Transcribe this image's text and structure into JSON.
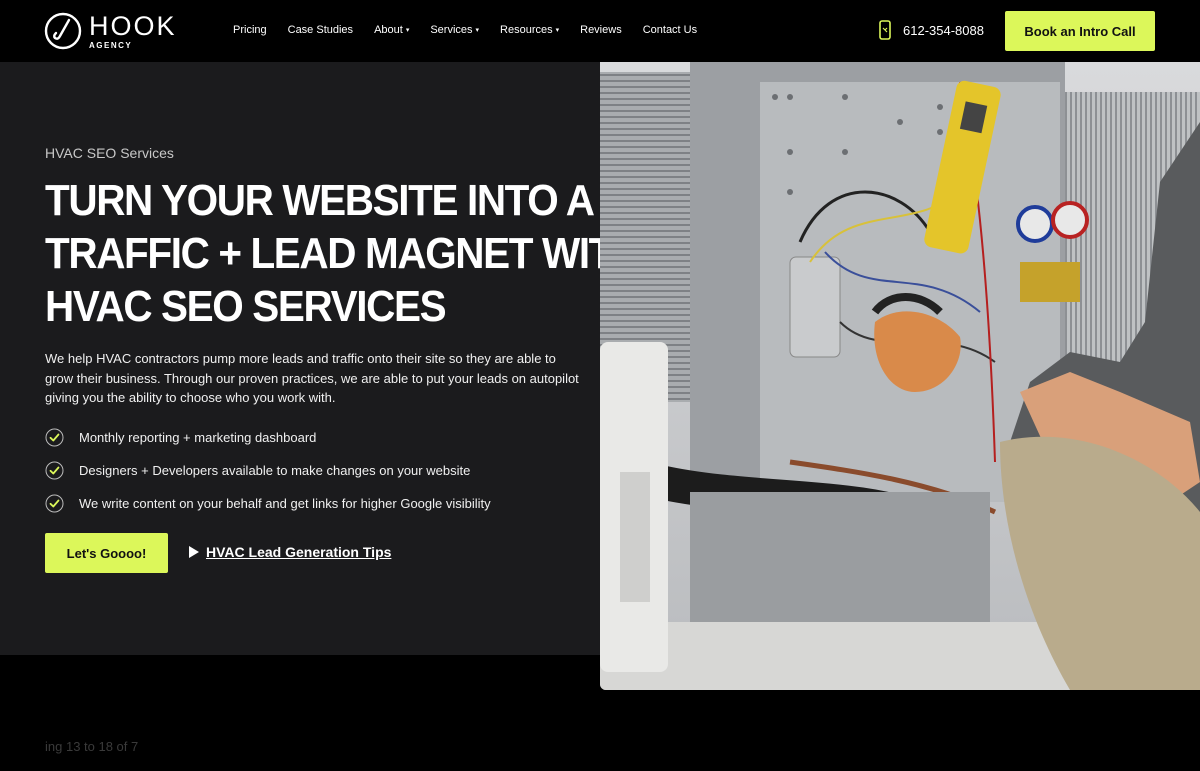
{
  "brand": {
    "name": "HOOK",
    "sub": "AGENCY",
    "logo_icon": "hook-logo-icon"
  },
  "nav": {
    "items": [
      {
        "label": "Pricing",
        "dropdown": false
      },
      {
        "label": "Case Studies",
        "dropdown": false
      },
      {
        "label": "About",
        "dropdown": true
      },
      {
        "label": "Services",
        "dropdown": true
      },
      {
        "label": "Resources",
        "dropdown": true
      },
      {
        "label": "Reviews",
        "dropdown": false
      },
      {
        "label": "Contact Us",
        "dropdown": false
      }
    ],
    "caret": "▾"
  },
  "header": {
    "phone": "612-354-8088",
    "phone_icon": "phone-icon",
    "cta": "Book an Intro Call"
  },
  "hero": {
    "eyebrow": "HVAC SEO Services",
    "headline": [
      "TURN YOUR WEBSITE INTO A",
      "TRAFFIC + LEAD MAGNET WITH",
      "HVAC SEO SERVICES"
    ],
    "description": "We help HVAC contractors pump more leads and traffic onto their site so they are able to grow their business. Through our proven practices, we are able to put your leads on autopilot giving you the ability to choose who you work with.",
    "checklist": [
      "Monthly reporting + marketing dashboard",
      "Designers + Developers available to make changes on your website",
      "We write content on your behalf and get links for higher Google visibility"
    ],
    "primary_button": "Let's Goooo!",
    "secondary_link": "HVAC Lead Generation Tips",
    "image_icon": "hvac-technician-photo"
  },
  "pager": {
    "text": "ing 13 to 18 of 7"
  },
  "colors": {
    "accent": "#dcf75a",
    "hero_bg": "#1b1b1d",
    "page_bg": "#000000"
  }
}
